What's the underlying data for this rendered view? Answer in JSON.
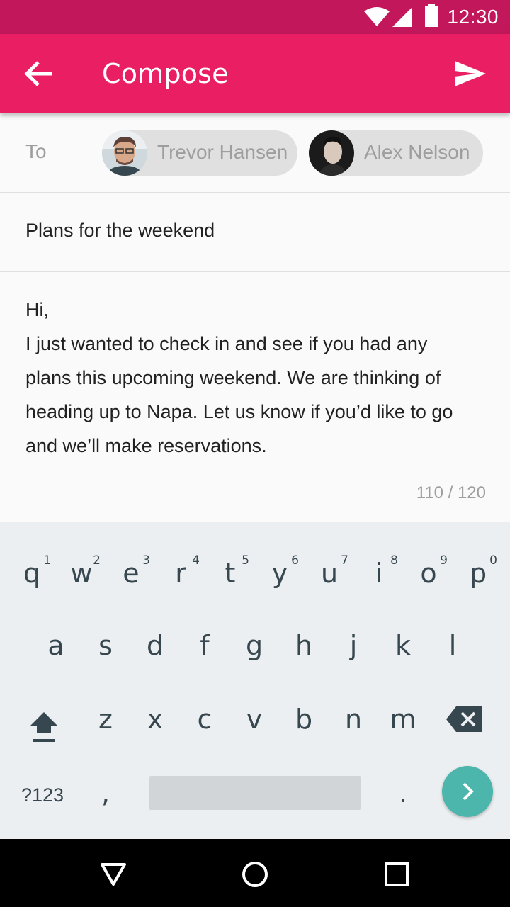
{
  "status_bar": {
    "time": "12:30",
    "icons": [
      "wifi-icon",
      "signal-icon",
      "battery-icon"
    ],
    "color": "#c2185b"
  },
  "app_bar": {
    "title": "Compose",
    "icons": [
      "back-arrow-icon",
      "send-icon"
    ],
    "color": "#e91e63"
  },
  "recipients": {
    "label": "To",
    "chips": [
      {
        "name": "Trevor Hansen"
      },
      {
        "name": "Alex Nelson"
      }
    ]
  },
  "subject": "Plans for the weekend",
  "body": {
    "lines": [
      "Hi,",
      "I just wanted to check in and see if you had any",
      "plans this upcoming weekend. We are thinking of",
      "heading up to Napa. Let us know if you’d like to go",
      "and we’ll make reservations."
    ],
    "counter": "110 / 120"
  },
  "keyboard": {
    "row1": [
      {
        "k": "q",
        "h": "1"
      },
      {
        "k": "w",
        "h": "2"
      },
      {
        "k": "e",
        "h": "3"
      },
      {
        "k": "r",
        "h": "4"
      },
      {
        "k": "t",
        "h": "5"
      },
      {
        "k": "y",
        "h": "6"
      },
      {
        "k": "u",
        "h": "7"
      },
      {
        "k": "i",
        "h": "8"
      },
      {
        "k": "o",
        "h": "9"
      },
      {
        "k": "p",
        "h": "0"
      }
    ],
    "row2": [
      "a",
      "s",
      "d",
      "f",
      "g",
      "h",
      "j",
      "k",
      "l"
    ],
    "row3": [
      "z",
      "x",
      "c",
      "v",
      "b",
      "n",
      "m"
    ],
    "symbols_key": "?123",
    "comma_key": ",",
    "period_key": ".",
    "accent_color": "#4db6ac",
    "icons": [
      "shift-icon",
      "backspace-icon",
      "next-arrow-icon"
    ]
  },
  "nav_bar": {
    "icons": [
      "back-triangle-icon",
      "home-circle-icon",
      "recents-square-icon"
    ]
  }
}
